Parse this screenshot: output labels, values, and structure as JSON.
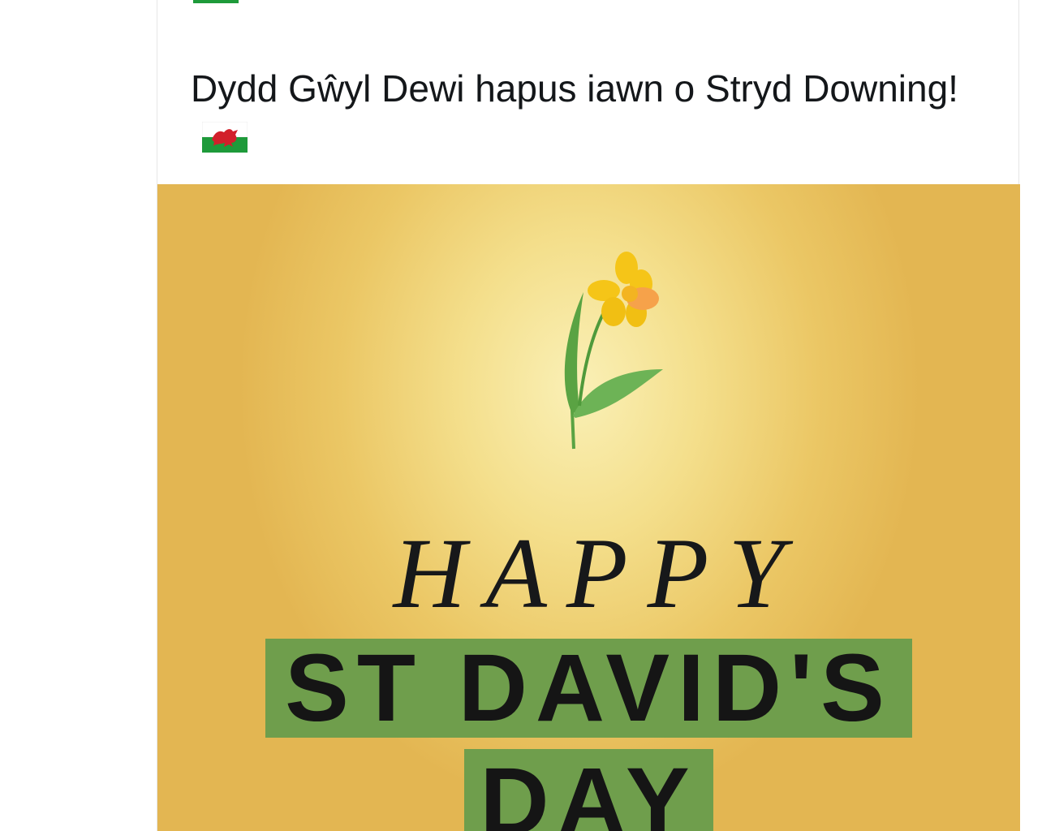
{
  "tweet": {
    "text": "Dydd Gŵyl Dewi hapus iawn o Stryd Downing!",
    "flag_icon": "wales-flag-icon"
  },
  "media": {
    "line1": "HAPPY",
    "line2": "ST DAVID'S",
    "line3": "DAY",
    "colors": {
      "background": "#ebc765",
      "band": "#6f9e4c",
      "text": "#151515"
    },
    "illustration": "daffodil-icon"
  }
}
